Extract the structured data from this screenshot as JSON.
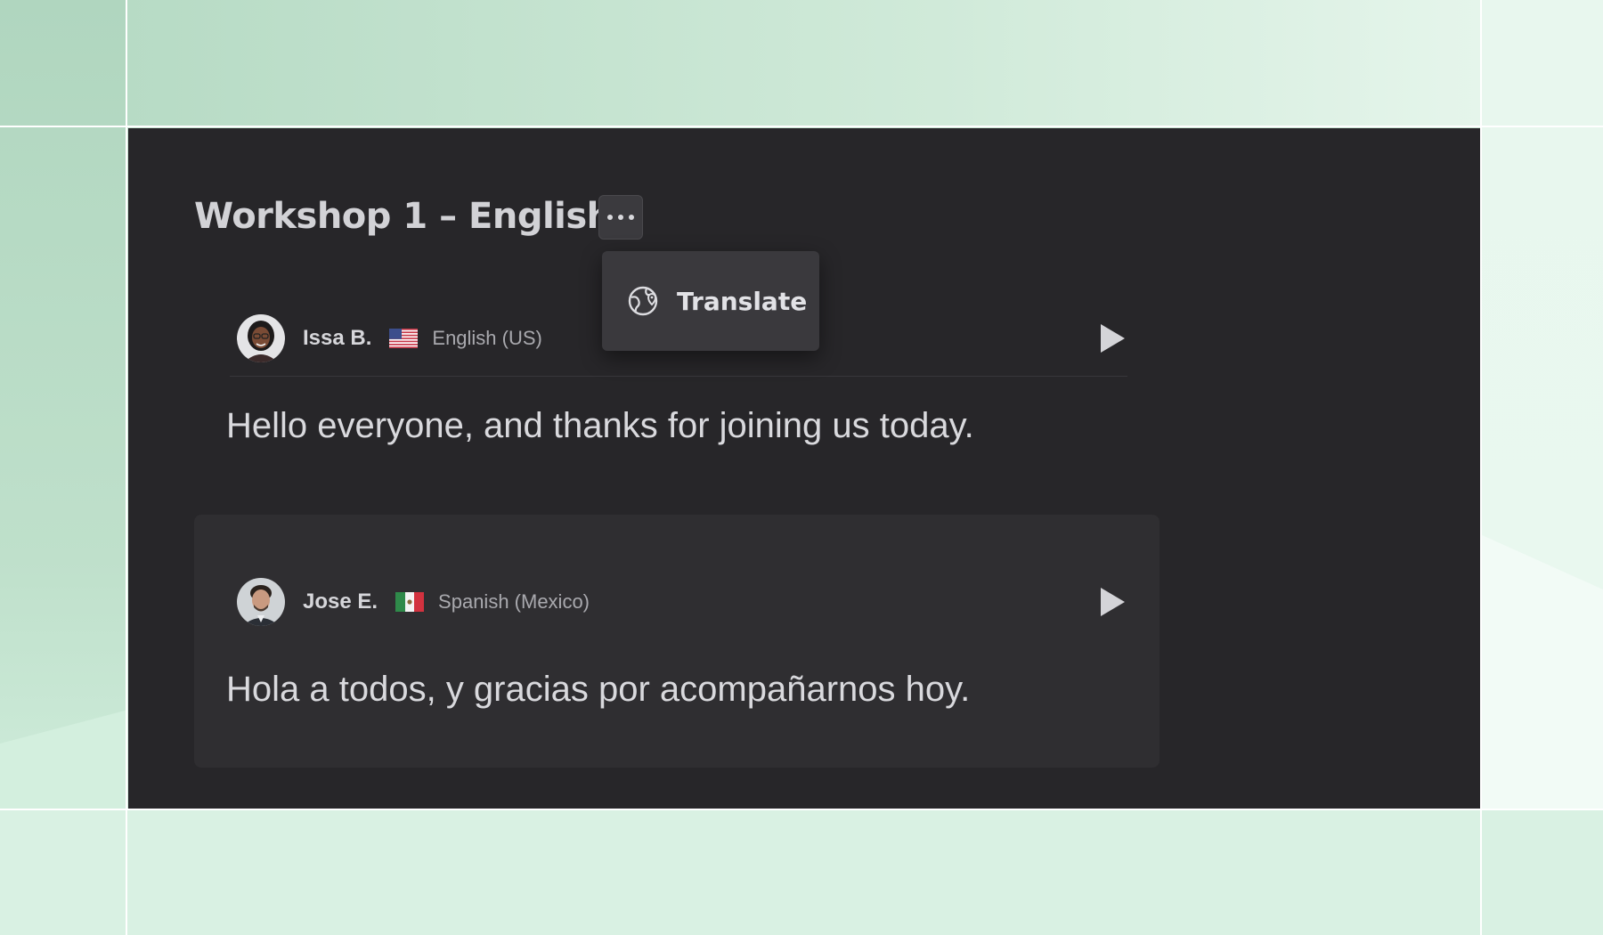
{
  "workshop": {
    "title": "Workshop 1 – English",
    "more_button_label": "More options"
  },
  "menu": {
    "items": [
      {
        "label": "Translate",
        "icon": "globe-icon"
      }
    ]
  },
  "messages": [
    {
      "speaker": "Issa B.",
      "flag": "us-flag-icon",
      "language": "English (US)",
      "text": "Hello everyone, and thanks for joining us today."
    },
    {
      "speaker": "Jose E.",
      "flag": "mexico-flag-icon",
      "language": "Spanish (Mexico)",
      "text": "Hola a todos, y gracias por acompañarnos hoy."
    }
  ],
  "colors": {
    "panel_background": "#272629",
    "card_background": "#2f2e31",
    "menu_background": "#3a393d",
    "text_primary": "#d9d9dd",
    "text_secondary": "#a9a9ae",
    "page_background": "#c2e0cd"
  }
}
